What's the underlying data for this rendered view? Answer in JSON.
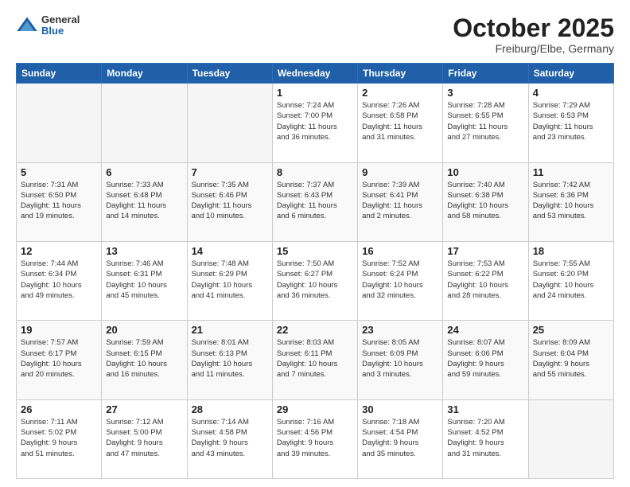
{
  "header": {
    "logo": {
      "general": "General",
      "blue": "Blue"
    },
    "month": "October 2025",
    "location": "Freiburg/Elbe, Germany"
  },
  "weekdays": [
    "Sunday",
    "Monday",
    "Tuesday",
    "Wednesday",
    "Thursday",
    "Friday",
    "Saturday"
  ],
  "weeks": [
    [
      {
        "day": "",
        "info": ""
      },
      {
        "day": "",
        "info": ""
      },
      {
        "day": "",
        "info": ""
      },
      {
        "day": "1",
        "info": "Sunrise: 7:24 AM\nSunset: 7:00 PM\nDaylight: 11 hours\nand 36 minutes."
      },
      {
        "day": "2",
        "info": "Sunrise: 7:26 AM\nSunset: 6:58 PM\nDaylight: 11 hours\nand 31 minutes."
      },
      {
        "day": "3",
        "info": "Sunrise: 7:28 AM\nSunset: 6:55 PM\nDaylight: 11 hours\nand 27 minutes."
      },
      {
        "day": "4",
        "info": "Sunrise: 7:29 AM\nSunset: 6:53 PM\nDaylight: 11 hours\nand 23 minutes."
      }
    ],
    [
      {
        "day": "5",
        "info": "Sunrise: 7:31 AM\nSunset: 6:50 PM\nDaylight: 11 hours\nand 19 minutes."
      },
      {
        "day": "6",
        "info": "Sunrise: 7:33 AM\nSunset: 6:48 PM\nDaylight: 11 hours\nand 14 minutes."
      },
      {
        "day": "7",
        "info": "Sunrise: 7:35 AM\nSunset: 6:46 PM\nDaylight: 11 hours\nand 10 minutes."
      },
      {
        "day": "8",
        "info": "Sunrise: 7:37 AM\nSunset: 6:43 PM\nDaylight: 11 hours\nand 6 minutes."
      },
      {
        "day": "9",
        "info": "Sunrise: 7:39 AM\nSunset: 6:41 PM\nDaylight: 11 hours\nand 2 minutes."
      },
      {
        "day": "10",
        "info": "Sunrise: 7:40 AM\nSunset: 6:38 PM\nDaylight: 10 hours\nand 58 minutes."
      },
      {
        "day": "11",
        "info": "Sunrise: 7:42 AM\nSunset: 6:36 PM\nDaylight: 10 hours\nand 53 minutes."
      }
    ],
    [
      {
        "day": "12",
        "info": "Sunrise: 7:44 AM\nSunset: 6:34 PM\nDaylight: 10 hours\nand 49 minutes."
      },
      {
        "day": "13",
        "info": "Sunrise: 7:46 AM\nSunset: 6:31 PM\nDaylight: 10 hours\nand 45 minutes."
      },
      {
        "day": "14",
        "info": "Sunrise: 7:48 AM\nSunset: 6:29 PM\nDaylight: 10 hours\nand 41 minutes."
      },
      {
        "day": "15",
        "info": "Sunrise: 7:50 AM\nSunset: 6:27 PM\nDaylight: 10 hours\nand 36 minutes."
      },
      {
        "day": "16",
        "info": "Sunrise: 7:52 AM\nSunset: 6:24 PM\nDaylight: 10 hours\nand 32 minutes."
      },
      {
        "day": "17",
        "info": "Sunrise: 7:53 AM\nSunset: 6:22 PM\nDaylight: 10 hours\nand 28 minutes."
      },
      {
        "day": "18",
        "info": "Sunrise: 7:55 AM\nSunset: 6:20 PM\nDaylight: 10 hours\nand 24 minutes."
      }
    ],
    [
      {
        "day": "19",
        "info": "Sunrise: 7:57 AM\nSunset: 6:17 PM\nDaylight: 10 hours\nand 20 minutes."
      },
      {
        "day": "20",
        "info": "Sunrise: 7:59 AM\nSunset: 6:15 PM\nDaylight: 10 hours\nand 16 minutes."
      },
      {
        "day": "21",
        "info": "Sunrise: 8:01 AM\nSunset: 6:13 PM\nDaylight: 10 hours\nand 11 minutes."
      },
      {
        "day": "22",
        "info": "Sunrise: 8:03 AM\nSunset: 6:11 PM\nDaylight: 10 hours\nand 7 minutes."
      },
      {
        "day": "23",
        "info": "Sunrise: 8:05 AM\nSunset: 6:09 PM\nDaylight: 10 hours\nand 3 minutes."
      },
      {
        "day": "24",
        "info": "Sunrise: 8:07 AM\nSunset: 6:06 PM\nDaylight: 9 hours\nand 59 minutes."
      },
      {
        "day": "25",
        "info": "Sunrise: 8:09 AM\nSunset: 6:04 PM\nDaylight: 9 hours\nand 55 minutes."
      }
    ],
    [
      {
        "day": "26",
        "info": "Sunrise: 7:11 AM\nSunset: 5:02 PM\nDaylight: 9 hours\nand 51 minutes."
      },
      {
        "day": "27",
        "info": "Sunrise: 7:12 AM\nSunset: 5:00 PM\nDaylight: 9 hours\nand 47 minutes."
      },
      {
        "day": "28",
        "info": "Sunrise: 7:14 AM\nSunset: 4:58 PM\nDaylight: 9 hours\nand 43 minutes."
      },
      {
        "day": "29",
        "info": "Sunrise: 7:16 AM\nSunset: 4:56 PM\nDaylight: 9 hours\nand 39 minutes."
      },
      {
        "day": "30",
        "info": "Sunrise: 7:18 AM\nSunset: 4:54 PM\nDaylight: 9 hours\nand 35 minutes."
      },
      {
        "day": "31",
        "info": "Sunrise: 7:20 AM\nSunset: 4:52 PM\nDaylight: 9 hours\nand 31 minutes."
      },
      {
        "day": "",
        "info": ""
      }
    ]
  ]
}
